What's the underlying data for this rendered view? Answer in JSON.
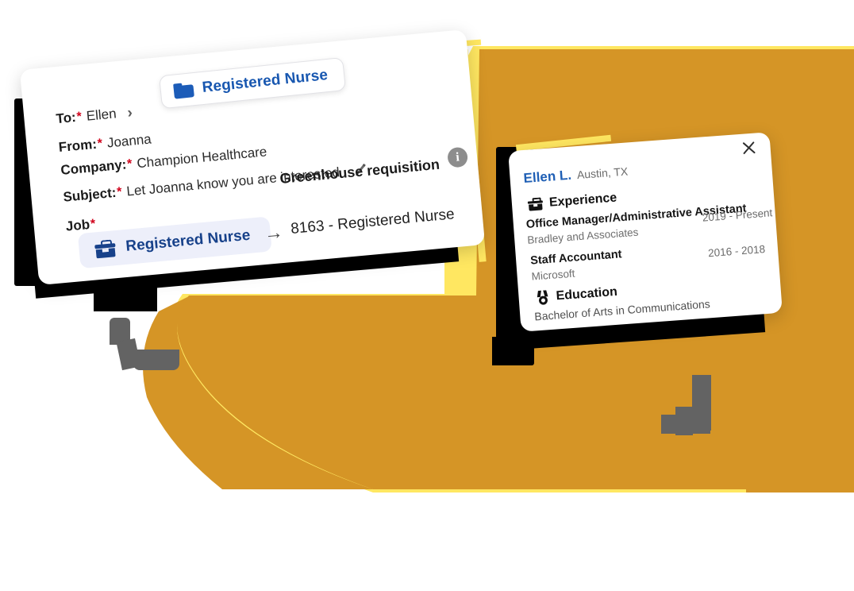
{
  "theme": {
    "accent_orange": "#D59526",
    "highlight_yellow": "#FFE761",
    "link_blue": "#1857B0",
    "chip_bg": "#EDEFFA",
    "chip_text": "#17418A",
    "required_red": "#D0021B",
    "dark_fragment": "#000000",
    "gray_fragment": "#636363",
    "card_bg": "#FFFFFF"
  },
  "compose_card": {
    "fields": [
      {
        "label": "To:",
        "required": true,
        "value": "Ellen",
        "chevron": "›"
      },
      {
        "label": "From:",
        "required": true,
        "value": "Joanna"
      },
      {
        "label": "Company:",
        "required": true,
        "value": "Champion Healthcare"
      },
      {
        "label": "Subject:",
        "required": true,
        "value": "Let Joanna know you are interested"
      }
    ],
    "folder_pill": {
      "icon": "folder-icon",
      "label": "Registered Nurse"
    },
    "edit_icon": "pencil-icon",
    "greenhouse_label": "Greenhouse requisition",
    "info_icon": "info-icon",
    "info_icon_glyph": "i",
    "job_section": {
      "label": "Job",
      "required": true,
      "chip": {
        "icon": "briefcase-icon",
        "label": "Registered Nurse"
      },
      "arrow": "→",
      "requisition": "8163 - Registered Nurse"
    }
  },
  "profile_card": {
    "close_icon": "close-icon",
    "name": "Ellen L.",
    "location": "Austin, TX",
    "experience": {
      "icon": "briefcase-icon",
      "heading": "Experience",
      "items": [
        {
          "title": "Office Manager/Administrative Assistant",
          "org": "Bradley and Associates",
          "dates": "2019 - Present"
        },
        {
          "title": "Staff Accountant",
          "org": "Microsoft",
          "dates": "2016 - 2018"
        }
      ]
    },
    "education": {
      "icon": "medal-icon",
      "heading": "Education",
      "degree": "Bachelor of Arts in Communications"
    }
  }
}
